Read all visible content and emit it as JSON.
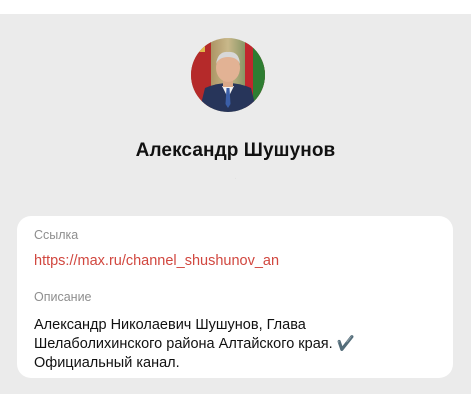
{
  "profile": {
    "name": "Александр Шушунов",
    "subtitle": "·"
  },
  "info_card": {
    "link_label": "Ссылка",
    "link_value": "https://max.ru/channel_shushunov_an",
    "description_label": "Описание",
    "description_lines": [
      "Александр Николаевич Шушунов, Глава",
      "Шелаболихинского района Алтайского края. ✔️",
      "Официальный канал."
    ]
  },
  "colors": {
    "background": "#ebebeb",
    "card": "#ffffff",
    "link": "#d1473f",
    "label": "#8e8e8e",
    "text": "#111111"
  },
  "icons": {
    "avatar": "profile-photo"
  }
}
